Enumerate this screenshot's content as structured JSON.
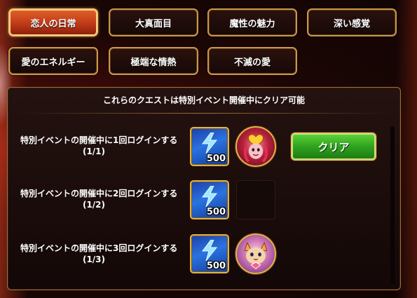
{
  "tabs": [
    {
      "label": "恋人の日常",
      "active": true
    },
    {
      "label": "大真面目",
      "active": false
    },
    {
      "label": "魔性の魅力",
      "active": false
    },
    {
      "label": "深い感覚",
      "active": false
    },
    {
      "label": "愛のエネルギー",
      "active": false
    },
    {
      "label": "極端な情熱",
      "active": false
    },
    {
      "label": "不滅の愛",
      "active": false
    }
  ],
  "panel": {
    "header": "これらのクエストは特別イベント開催中にクリア可能"
  },
  "quests": [
    {
      "description": "特別イベントの開催中に1回ログインする",
      "progress": "(1/1)",
      "reward_icon": "energy-bolt-icon",
      "reward_count": "500",
      "hero_portrait": "heart-demon-portrait",
      "action": "クリア"
    },
    {
      "description": "特別イベントの開催中に2回ログインする",
      "progress": "(1/2)",
      "reward_icon": "energy-bolt-icon",
      "reward_count": "500",
      "hero_portrait": null,
      "action": null
    },
    {
      "description": "特別イベントの開催中に3回ログインする",
      "progress": "(1/3)",
      "reward_icon": "energy-bolt-icon",
      "reward_count": "500",
      "hero_portrait": "cat-mage-portrait",
      "action": null
    }
  ],
  "colors": {
    "active_tab": "#d14a20",
    "tab_border": "#c9974a",
    "clear_button": "#2ea21e",
    "reward_bg": "#2a73e0"
  }
}
